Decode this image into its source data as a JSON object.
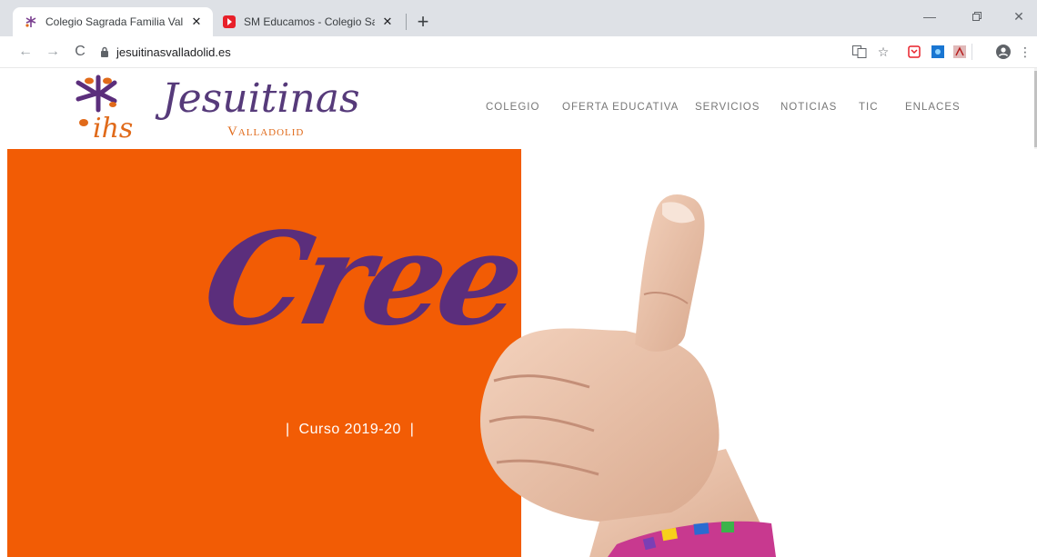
{
  "browser": {
    "tabs": [
      {
        "title": "Colegio Sagrada Familia Valladolid",
        "active": true,
        "favicon": "ihs-logo-icon"
      },
      {
        "title": "SM Educamos - Colegio Sagrada",
        "active": false,
        "favicon": "sm-educamos-icon"
      }
    ],
    "address": "jesuitinasvalladolid.es"
  },
  "site": {
    "logo": {
      "wordmark": "Jesuitinas",
      "sub": "Valladolid",
      "monogram": "ihs"
    },
    "menu": [
      "COLEGIO",
      "OFERTA EDUCATIVA",
      "SERVICIOS",
      "NOTICIAS",
      "TIC",
      "ENLACES"
    ]
  },
  "hero": {
    "headline": "Cree",
    "course": "|  Curso 2019-20  |",
    "colors": {
      "orange": "#f25c05",
      "purple": "#5b2e7c"
    }
  }
}
